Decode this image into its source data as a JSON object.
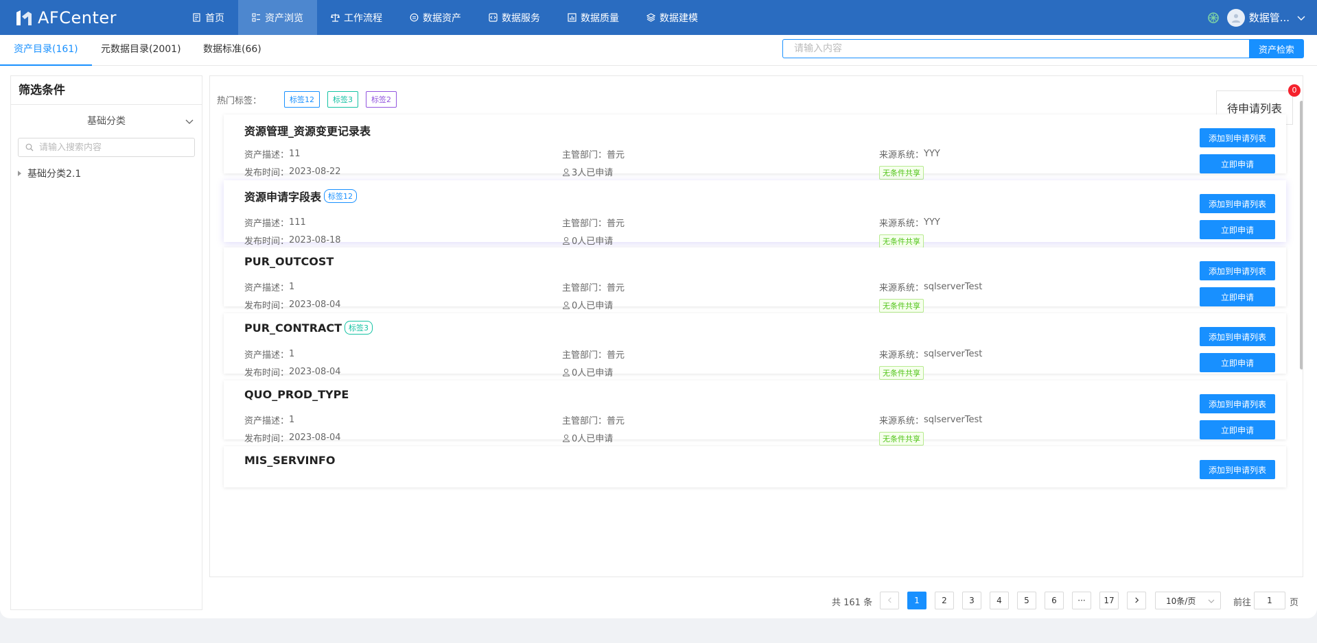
{
  "app": {
    "name": "AFCenter"
  },
  "nav": {
    "items": [
      {
        "label": "首页",
        "icon": "document-icon"
      },
      {
        "label": "资产浏览",
        "icon": "list-icon",
        "active": true
      },
      {
        "label": "工作流程",
        "icon": "balance-icon"
      },
      {
        "label": "数据资产",
        "icon": "database-icon"
      },
      {
        "label": "数据服务",
        "icon": "code-icon"
      },
      {
        "label": "数据质量",
        "icon": "bar-chart-icon"
      },
      {
        "label": "数据建模",
        "icon": "layers-icon"
      }
    ],
    "user_name": "数据管..."
  },
  "tabs": [
    {
      "label": "资产目录(161)",
      "active": true
    },
    {
      "label": "元数据目录(2001)"
    },
    {
      "label": "数据标准(66)"
    }
  ],
  "search": {
    "placeholder": "请输入内容",
    "button_label": "资产检索"
  },
  "filter": {
    "title": "筛选条件",
    "category_label": "基础分类",
    "search_placeholder": "请输入搜索内容",
    "tree": [
      {
        "label": "基础分类2.1"
      }
    ]
  },
  "hot_tags": {
    "label": "热门标签：",
    "tags": [
      {
        "label": "标签12",
        "color": "#1890ff"
      },
      {
        "label": "标签3",
        "color": "#13c2a3"
      },
      {
        "label": "标签2",
        "color": "#9254de"
      }
    ]
  },
  "pending": {
    "label": "待申请列表",
    "count": "0"
  },
  "assets": [
    {
      "title": "资源管理_资源变更记录表",
      "tag": null,
      "desc_label": "资产描述：",
      "desc": "11",
      "dept_label": "主管部门：",
      "dept": "普元",
      "source_label": "来源系统：",
      "source": "YYY",
      "time_label": "发布时间：",
      "time": "2023-08-22",
      "applied": "3人已申请",
      "share": "无条件共享",
      "add_label": "添加到申请列表",
      "apply_label": "立即申请"
    },
    {
      "title": "资源申请字段表",
      "tag": "标签12",
      "tag_color": "#1890ff",
      "desc_label": "资产描述：",
      "desc": "111",
      "dept_label": "主管部门：",
      "dept": "普元",
      "source_label": "来源系统：",
      "source": "YYY",
      "time_label": "发布时间：",
      "time": "2023-08-18",
      "applied": "0人已申请",
      "share": "无条件共享",
      "add_label": "添加到申请列表",
      "apply_label": "立即申请"
    },
    {
      "title": "PUR_OUTCOST",
      "tag": null,
      "desc_label": "资产描述：",
      "desc": "1",
      "dept_label": "主管部门：",
      "dept": "普元",
      "source_label": "来源系统：",
      "source": "sqlserverTest",
      "time_label": "发布时间：",
      "time": "2023-08-04",
      "applied": "0人已申请",
      "share": "无条件共享",
      "add_label": "添加到申请列表",
      "apply_label": "立即申请"
    },
    {
      "title": "PUR_CONTRACT",
      "tag": "标签3",
      "tag_color": "#13c2a3",
      "desc_label": "资产描述：",
      "desc": "1",
      "dept_label": "主管部门：",
      "dept": "普元",
      "source_label": "来源系统：",
      "source": "sqlserverTest",
      "time_label": "发布时间：",
      "time": "2023-08-04",
      "applied": "0人已申请",
      "share": "无条件共享",
      "add_label": "添加到申请列表",
      "apply_label": "立即申请"
    },
    {
      "title": "QUO_PROD_TYPE",
      "tag": null,
      "desc_label": "资产描述：",
      "desc": "1",
      "dept_label": "主管部门：",
      "dept": "普元",
      "source_label": "来源系统：",
      "source": "sqlserverTest",
      "time_label": "发布时间：",
      "time": "2023-08-04",
      "applied": "0人已申请",
      "share": "无条件共享",
      "add_label": "添加到申请列表",
      "apply_label": "立即申请"
    },
    {
      "title": "MIS_SERVINFO",
      "tag": null,
      "add_label": "添加到申请列表"
    }
  ],
  "pagination": {
    "total": "共 161 条",
    "pages": [
      "1",
      "2",
      "3",
      "4",
      "5",
      "6",
      "···",
      "17"
    ],
    "current": "1",
    "page_size": "10条/页",
    "goto_label": "前往",
    "goto_value": "1",
    "goto_suffix": "页"
  }
}
